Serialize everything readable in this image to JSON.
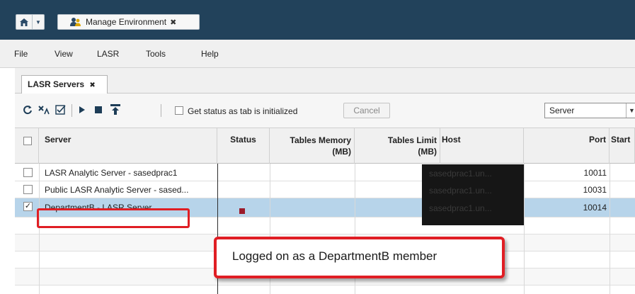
{
  "app": {
    "tab_title": "Manage Environment",
    "tab_close": "✖"
  },
  "menu": [
    "File",
    "View",
    "LASR",
    "Tools",
    "Help"
  ],
  "content_tab": {
    "title": "LASR Servers",
    "close": "✖"
  },
  "toolbar": {
    "status_checkbox_label": "Get status as tab is initialized",
    "status_checked": false,
    "cancel_label": "Cancel",
    "cancel_enabled": false,
    "filter_value": "Server"
  },
  "grid": {
    "columns": [
      {
        "id": "select",
        "label": ""
      },
      {
        "id": "server",
        "label": "Server"
      },
      {
        "id": "status",
        "label": "Status"
      },
      {
        "id": "tables_memory",
        "label": "Tables Memory\n(MB)"
      },
      {
        "id": "tables_limit",
        "label": "Tables Limit\n(MB)"
      },
      {
        "id": "host",
        "label": "Host"
      },
      {
        "id": "port",
        "label": "Port"
      },
      {
        "id": "start",
        "label": "Start"
      }
    ],
    "rows": [
      {
        "checked": false,
        "server": "LASR Analytic Server - sasedprac1",
        "status": "",
        "host": "sasedprac1.un...",
        "port": "10011",
        "selected": false
      },
      {
        "checked": false,
        "server": "Public LASR Analytic Server - sased...",
        "status": "",
        "host": "sasedprac1.un...",
        "port": "10031",
        "selected": false
      },
      {
        "checked": true,
        "server": "DepartmentB - LASR Server",
        "status": "stopped",
        "host": "sasedprac1.un...",
        "port": "10014",
        "selected": true
      }
    ]
  },
  "callout": {
    "text": "Logged on as a DepartmentB member"
  },
  "colors": {
    "topbar": "#22425b",
    "selection": "#b7d4ea",
    "highlight": "#e01e24",
    "status_stopped": "#9b1b2a"
  }
}
